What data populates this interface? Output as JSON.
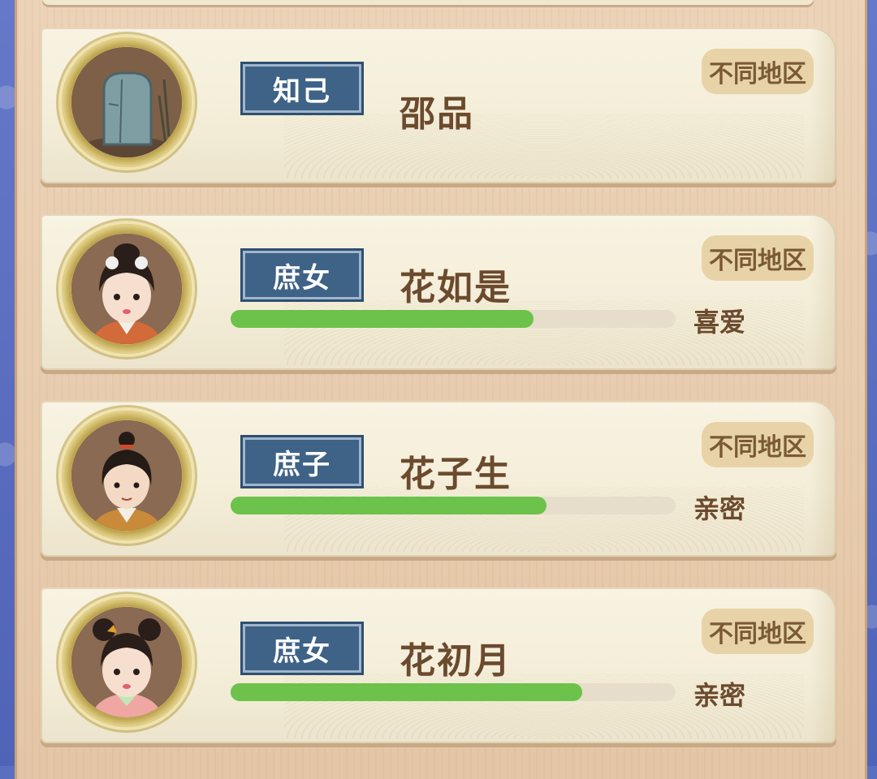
{
  "region_label": "不同地区",
  "contacts": [
    {
      "tag": "知己",
      "name": "邵品",
      "avatar_icon": "stone-tablet-icon",
      "relation": null,
      "affinity": null
    },
    {
      "tag": "庶女",
      "name": "花如是",
      "avatar_icon": "female-portrait-icon",
      "relation": "喜爱",
      "affinity": 0.68
    },
    {
      "tag": "庶子",
      "name": "花子生",
      "avatar_icon": "male-portrait-icon",
      "relation": "亲密",
      "affinity": 0.71
    },
    {
      "tag": "庶女",
      "name": "花初月",
      "avatar_icon": "female-portrait-icon",
      "relation": "亲密",
      "affinity": 0.79
    }
  ],
  "colors": {
    "tag_bg": "#3f6287",
    "bar_fill": "#6cc24a",
    "bar_track": "#e6ddcb",
    "text_brown": "#6b4a2e"
  }
}
